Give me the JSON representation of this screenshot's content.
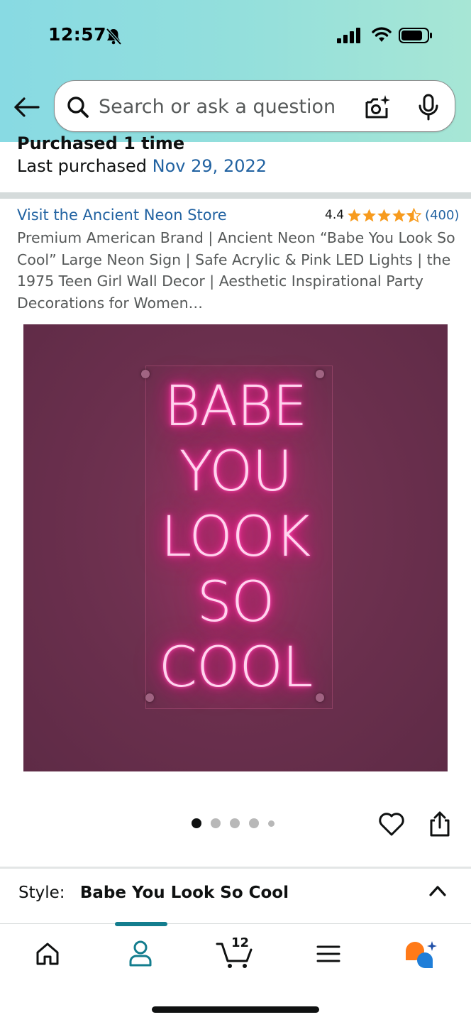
{
  "status_bar": {
    "time": "12:57",
    "icons": [
      "bell-slash-icon",
      "signal-icon",
      "wifi-icon",
      "battery-icon"
    ]
  },
  "search": {
    "placeholder": "Search or ask a question",
    "value": "",
    "icons": [
      "back-arrow-icon",
      "search-icon",
      "camera-icon",
      "mic-icon"
    ]
  },
  "purchase_info": {
    "purchased_times": "Purchased 1 time",
    "last_purchased_label": "Last purchased",
    "last_purchased_date": "Nov 29, 2022"
  },
  "product": {
    "store_link": "Visit the Ancient Neon Store",
    "rating_value": "4.4",
    "rating_stars": 4.4,
    "rating_count": "(400)",
    "title": "Premium American Brand | Ancient Neon “Babe You Look So Cool” Large Neon Sign | Safe Acrylic & Pink LED Lights | the 1975 Teen Girl Wall Decor | Aesthetic Inspirational Party Decorations for Women…",
    "image_text_lines": [
      "BABE",
      "YOU",
      "LOOK",
      "SO",
      "COOL"
    ],
    "image_count": 5,
    "active_image_index": 0
  },
  "style": {
    "label": "Style:",
    "value": "Babe You Look So Cool"
  },
  "bottom_nav": {
    "items": [
      "home-icon",
      "account-icon",
      "cart-icon",
      "menu-icon",
      "rufus-icon"
    ],
    "cart_count": "12",
    "active_item": "account-icon"
  },
  "colors": {
    "header_gradient_start": "#88dae3",
    "header_gradient_end": "#a7e6d5",
    "link": "#2162a1",
    "star": "#f79b1e",
    "neon_pink": "#ff2e9f",
    "nav_accent": "#137d8e"
  }
}
